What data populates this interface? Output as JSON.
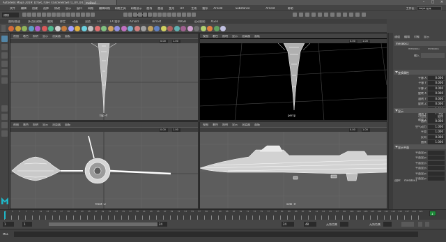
{
  "titlebar": {
    "title": "Autodesk Maya 2019: D:\\SR_T\\SR-71\\scenes\\SR71_UV_04.mb* --- mesBox1...",
    "active_tab": "msBox1..."
  },
  "menubar": {
    "items": [
      "文件",
      "编辑",
      "创建",
      "选择",
      "修改",
      "显示",
      "窗口",
      "网格",
      "编辑网格",
      "网格工具",
      "网格显示",
      "曲线",
      "曲面",
      "变形",
      "UV",
      "生成",
      "缓存",
      "Arnold",
      "Substance",
      "Arnold",
      "帮助"
    ],
    "workspace_label": "工作区:",
    "workspace_value": "Maya 经典"
  },
  "statusline": {
    "mode": "建模",
    "live_field": "无激活对象"
  },
  "shelf": {
    "tabs": [
      "曲线/曲面",
      "多边形建模",
      "雕刻",
      "绑定",
      "动画",
      "渲染",
      "FX",
      "FX 缓存",
      "Arnold",
      "Bifrost",
      "MASH",
      "运动图形",
      "XGen"
    ],
    "icon_colors": [
      "#d26a3a",
      "#c9a23a",
      "#8fb35b",
      "#5aa0c6",
      "#b05fc7",
      "#d85a5a",
      "#4fb88f",
      "#d0d0d0",
      "#c47a3d",
      "#a0a0ff",
      "#e0b040",
      "#6ad0e0",
      "#c0c0c0",
      "#e07070",
      "#80c080",
      "#d0a060",
      "#9090e0",
      "#c070c0",
      "#70b0d0",
      "#d08080",
      "#a0a0a0",
      "#c0a060",
      "#6080c0",
      "#d0d060",
      "#b06060",
      "#60b0b0",
      "#a06090",
      "#d0a0d0",
      "#707070",
      "#b0d070",
      "#e08040",
      "#60a060",
      "#c0c0e0"
    ]
  },
  "viewports": {
    "menu": [
      "视图",
      "着色",
      "照明",
      "显示",
      "渲染器",
      "面板"
    ],
    "field_a": "0.00",
    "field_b": "1.00",
    "top_left_label": "top -Y",
    "top_right_label": "persp",
    "bottom_left_label": "front -Z",
    "bottom_right_label": "side -X"
  },
  "channel_box": {
    "tabs": [
      "通道",
      "编辑",
      "对象",
      "显示"
    ],
    "object_name": "mesBox1",
    "shape_tab_1": "mesBox1",
    "shape_tab_2": "mesBox1",
    "inputs_label": "输入",
    "section_transform": "变换属性",
    "transform_rows": [
      {
        "label": "平移 X",
        "value": "0.000"
      },
      {
        "label": "平移 Y",
        "value": "0.000"
      },
      {
        "label": "平移 Z",
        "value": "0.000"
      },
      {
        "label": "旋转 X",
        "value": "0.000"
      },
      {
        "label": "旋转 Y",
        "value": "0.000"
      },
      {
        "label": "旋转 Z",
        "value": "0.000"
      },
      {
        "label": "缩放 X",
        "value": "1.000"
      },
      {
        "label": "缩放 Y",
        "value": "1.000"
      },
      {
        "label": "缩放 Z",
        "value": "1.000"
      }
    ],
    "section_display": "显示",
    "display_rows": [
      {
        "label": "可见性",
        "value": "启用"
      },
      {
        "label": "透明",
        "value": "0.000"
      },
      {
        "label": "空气动力",
        "value": "1.000"
      },
      {
        "label": "平滑",
        "value": "1.000"
      },
      {
        "label": "反向",
        "value": "0.000"
      },
      {
        "label": "曲线",
        "value": "1.000"
      }
    ],
    "section_extra": "显示平面",
    "extra_rows": [
      {
        "label": "平面显示",
        "value": ""
      },
      {
        "label": "平面显示",
        "value": ""
      },
      {
        "label": "平面显示",
        "value": ""
      },
      {
        "label": "平面显示",
        "value": ""
      },
      {
        "label": "平面显示",
        "value": ""
      },
      {
        "label": "平面显示",
        "value": ""
      }
    ],
    "footer_label": "选择:",
    "footer_value": "mesBox1"
  },
  "timeline": {
    "ticks": [
      "1",
      "3",
      "5",
      "7",
      "9",
      "11",
      "13",
      "15",
      "17",
      "19",
      "21",
      "23",
      "25",
      "27",
      "29",
      "31",
      "33",
      "35",
      "37",
      "39",
      "41",
      "43",
      "45",
      "47",
      "49",
      "51",
      "53",
      "55",
      "57",
      "59",
      "61",
      "63",
      "65",
      "67",
      "69",
      "71",
      "73",
      "75",
      "77",
      "79",
      "81",
      "83",
      "85",
      "87",
      "89",
      "91",
      "93",
      "95",
      "97",
      "99",
      "101",
      "103",
      "105",
      "107",
      "109",
      "111",
      "113",
      "115",
      "117",
      "119",
      "121"
    ],
    "current_frame": "1"
  },
  "range": {
    "start": "1",
    "inner_start": "1",
    "inner_end": "24",
    "end": "24",
    "max": "48",
    "anim_layer": "无角色集",
    "char_set": "无角色集"
  },
  "cmdline": {
    "mel_label": "MEL"
  },
  "colors": {
    "accent": "#5285a6",
    "viewport_gray": "#5d5d5d",
    "persp_bg": "#000000"
  }
}
